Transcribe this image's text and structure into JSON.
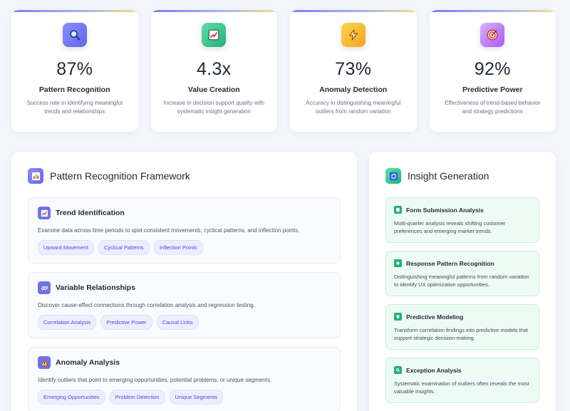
{
  "stats": [
    {
      "icon": "magnifier-icon",
      "value": "87%",
      "label": "Pattern Recognition",
      "desc": "Success rate in identifying meaningful trends and relationships"
    },
    {
      "icon": "trend-chart-icon",
      "value": "4.3x",
      "label": "Value Creation",
      "desc": "Increase in decision support quality with systematic insight generation"
    },
    {
      "icon": "lightning-icon",
      "value": "73%",
      "label": "Anomaly Detection",
      "desc": "Accuracy in distinguishing meaningful outliers from random variation"
    },
    {
      "icon": "target-icon",
      "value": "92%",
      "label": "Predictive Power",
      "desc": "Effectiveness of trend-based behavior and strategy predictions"
    }
  ],
  "framework": {
    "title": "Pattern Recognition Framework",
    "icon": "bar-chart-icon",
    "cards": [
      {
        "icon": "trend-chart-icon",
        "title": "Trend Identification",
        "desc": "Examine data across time periods to spot consistent movements, cyclical patterns, and inflection points.",
        "tags": [
          "Upward Movement",
          "Cyclical Patterns",
          "Inflection Points"
        ]
      },
      {
        "icon": "link-icon",
        "title": "Variable Relationships",
        "desc": "Discover cause-effect connections through correlation analysis and regression testing.",
        "tags": [
          "Correlation Analysis",
          "Predictive Power",
          "Causal Links"
        ]
      },
      {
        "icon": "warning-icon",
        "title": "Anomaly Analysis",
        "desc": "Identify outliers that point to emerging opportunities, potential problems, or unique segments.",
        "tags": [
          "Emerging Opportunities",
          "Problem Detection",
          "Unique Segments"
        ]
      }
    ]
  },
  "insights": {
    "title": "Insight Generation",
    "icon": "refresh-icon",
    "cards": [
      {
        "icon": "form-icon",
        "title": "Form Submission Analysis",
        "desc": "Multi-quarter analysis reveals shifting customer preferences and emerging market trends."
      },
      {
        "icon": "response-icon",
        "title": "Response Pattern Recognition",
        "desc": "Distinguishing meaningful patterns from random variation to identify UX optimization opportunities."
      },
      {
        "icon": "crystal-ball-icon",
        "title": "Predictive Modeling",
        "desc": "Transform correlation findings into predictive models that support strategic decision-making."
      },
      {
        "icon": "search-icon",
        "title": "Exception Analysis",
        "desc": "Systematic examination of outliers often reveals the most valuable insights."
      }
    ]
  }
}
